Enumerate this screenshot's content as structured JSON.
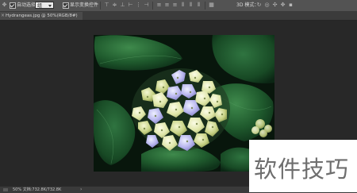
{
  "options_bar": {
    "auto_select_label": "自动选择：",
    "auto_select_value": "组",
    "show_transform_label": "显示变换控件",
    "mode_3d_label": "3D 模式："
  },
  "document_tab": {
    "title": "Hydrangeas.jpg @ 50%(RGB/8#)"
  },
  "status_bar": {
    "zoom": "50% 文档:732.8K/732.8K"
  },
  "watermark": {
    "text": "软件技巧"
  }
}
